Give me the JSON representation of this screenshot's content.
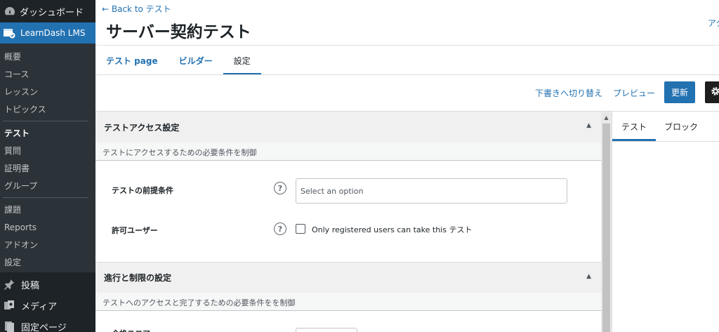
{
  "sidebar": {
    "dashboard_label": "ダッシュボード",
    "plugin_label": "LearnDash LMS",
    "sub_items_1": [
      "概要",
      "コース",
      "レッスン",
      "トピックス"
    ],
    "sub_items_2": [
      "テスト",
      "質問",
      "証明書",
      "グループ"
    ],
    "sub_items_3": [
      "課題",
      "Reports",
      "アドオン",
      "設定"
    ],
    "posts_label": "投稿",
    "media_label": "メディア",
    "pages_label": "固定ページ"
  },
  "header": {
    "back_link": "← Back to テスト",
    "title": "サーバー契約テスト",
    "right_link": "アク"
  },
  "tabs": [
    "テスト page",
    "ビルダー",
    "設定"
  ],
  "toolbar": {
    "draft_switch": "下書きへ切り替え",
    "preview": "プレビュー",
    "update": "更新"
  },
  "sections": {
    "access": {
      "title": "テストアクセス設定",
      "description": "テストにアクセスするための必要条件を制御",
      "prereq_label": "テストの前提条件",
      "select_placeholder": "Select an option",
      "allowed_label": "許可ユーザー",
      "checkbox_label": "Only registered users can take this テスト"
    },
    "progress": {
      "title": "進行と制限の設定",
      "description": "テストへのアクセスと完了するための必要条件をを制御",
      "partial_label": "合格スコア"
    }
  },
  "right_panel": {
    "tabs": [
      "テスト",
      "ブロック"
    ]
  },
  "colors": {
    "admin_bg": "#1d2327",
    "accent": "#2271b1"
  }
}
